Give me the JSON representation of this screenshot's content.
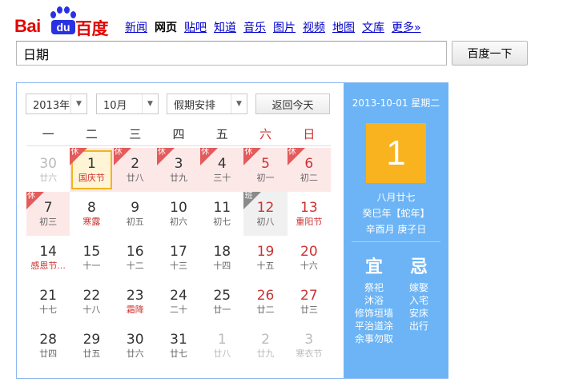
{
  "logo": {
    "bai": "Bai",
    "du": "du",
    "cn": "百度"
  },
  "nav": [
    "新闻",
    "网页",
    "贴吧",
    "知道",
    "音乐",
    "图片",
    "视频",
    "地图",
    "文库",
    "更多»"
  ],
  "nav_active_index": 1,
  "search": {
    "query": "日期",
    "button": "百度一下"
  },
  "calendar": {
    "year_select": "2013年",
    "month_select": "10月",
    "holiday_select": "假期安排",
    "today_button": "返回今天",
    "weekdays": [
      "一",
      "二",
      "三",
      "四",
      "五",
      "六",
      "日"
    ],
    "rows": [
      [
        {
          "d": "30",
          "l": "廿六",
          "other": true
        },
        {
          "d": "1",
          "l": "国庆节",
          "fest": true,
          "tag": "休",
          "selected": true
        },
        {
          "d": "2",
          "l": "廿八",
          "tag": "休"
        },
        {
          "d": "3",
          "l": "廿九",
          "tag": "休"
        },
        {
          "d": "4",
          "l": "三十",
          "tag": "休"
        },
        {
          "d": "5",
          "l": "初一",
          "tag": "休",
          "we": true
        },
        {
          "d": "6",
          "l": "初二",
          "tag": "休",
          "we": true
        }
      ],
      [
        {
          "d": "7",
          "l": "初三",
          "tag": "休"
        },
        {
          "d": "8",
          "l": "寒露",
          "term": true
        },
        {
          "d": "9",
          "l": "初五"
        },
        {
          "d": "10",
          "l": "初六"
        },
        {
          "d": "11",
          "l": "初七"
        },
        {
          "d": "12",
          "l": "初八",
          "tag": "班",
          "we": true
        },
        {
          "d": "13",
          "l": "重阳节",
          "fest": true,
          "we": true
        }
      ],
      [
        {
          "d": "14",
          "l": "感恩节...",
          "fest": true
        },
        {
          "d": "15",
          "l": "十一"
        },
        {
          "d": "16",
          "l": "十二"
        },
        {
          "d": "17",
          "l": "十三"
        },
        {
          "d": "18",
          "l": "十四"
        },
        {
          "d": "19",
          "l": "十五",
          "we": true
        },
        {
          "d": "20",
          "l": "十六",
          "we": true
        }
      ],
      [
        {
          "d": "21",
          "l": "十七"
        },
        {
          "d": "22",
          "l": "十八"
        },
        {
          "d": "23",
          "l": "霜降",
          "term": true
        },
        {
          "d": "24",
          "l": "二十"
        },
        {
          "d": "25",
          "l": "廿一"
        },
        {
          "d": "26",
          "l": "廿二",
          "we": true
        },
        {
          "d": "27",
          "l": "廿三",
          "we": true
        }
      ],
      [
        {
          "d": "28",
          "l": "廿四"
        },
        {
          "d": "29",
          "l": "廿五"
        },
        {
          "d": "30",
          "l": "廿六"
        },
        {
          "d": "31",
          "l": "廿七"
        },
        {
          "d": "1",
          "l": "廿八",
          "other": true
        },
        {
          "d": "2",
          "l": "廿九",
          "other": true
        },
        {
          "d": "3",
          "l": "寒衣节",
          "other": true
        }
      ]
    ]
  },
  "detail": {
    "date": "2013-10-01 星期二",
    "day": "1",
    "lunar": "八月廿七",
    "ganzhi_year": "癸巳年【蛇年】",
    "ganzhi_month_day": "辛酉月 庚子日",
    "yi_label": "宜",
    "ji_label": "忌",
    "yi": [
      "祭祀",
      "沐浴",
      "修饰垣墙",
      "平治道涂",
      "余事勿取"
    ],
    "ji": [
      "嫁娶",
      "入宅",
      "安床",
      "出行"
    ]
  },
  "colors": {
    "accent_blue": "#6cb4f5",
    "holiday_red": "#e35b5b",
    "today_orange": "#f9b31e",
    "brand_red": "#e10602",
    "brand_blue": "#2932e1"
  }
}
